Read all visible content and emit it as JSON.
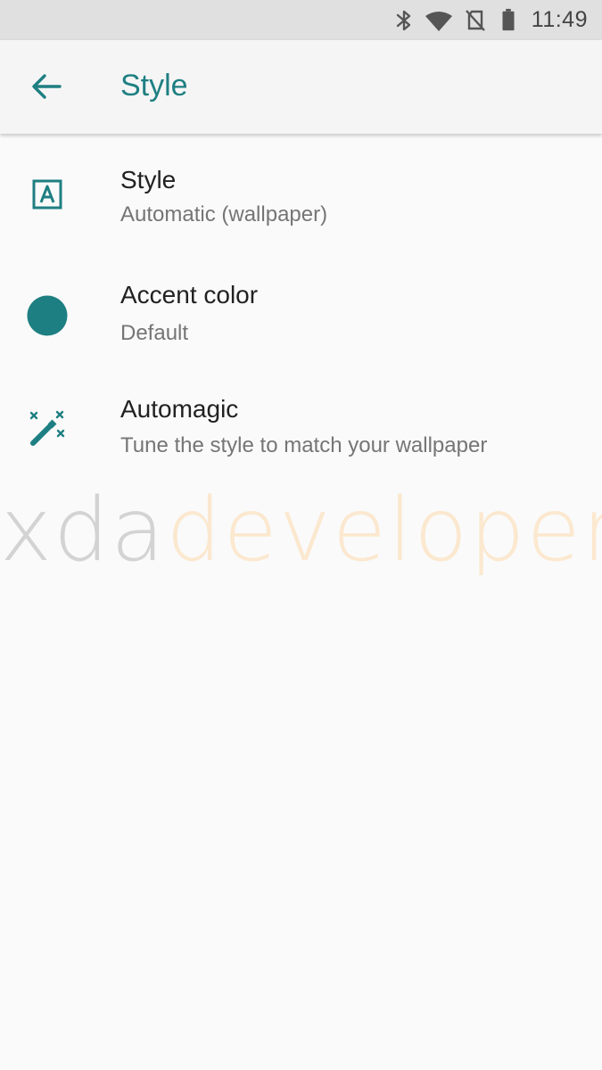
{
  "status_bar": {
    "time": "11:49",
    "icons": [
      "bluetooth-icon",
      "wifi-icon",
      "no-sim-icon",
      "battery-icon"
    ]
  },
  "app_bar": {
    "title": "Style",
    "back_icon": "arrow-back-icon"
  },
  "preferences": [
    {
      "title": "Style",
      "summary": "Automatic (wallpaper)",
      "icon": "style-a-icon"
    },
    {
      "title": "Accent color",
      "summary": "Default",
      "icon": "color-dot-icon"
    },
    {
      "title": "Automagic",
      "summary": "Tune the style to match your wallpaper",
      "icon": "magic-wand-icon"
    }
  ],
  "watermark": {
    "part1": "xda",
    "part2": "developers"
  },
  "colors": {
    "accent": "#1e7f82",
    "background": "#fafafa",
    "status_bar": "#e0e0e0",
    "app_bar": "#f5f5f5",
    "title_text": "#212121",
    "summary_text": "#757575"
  }
}
